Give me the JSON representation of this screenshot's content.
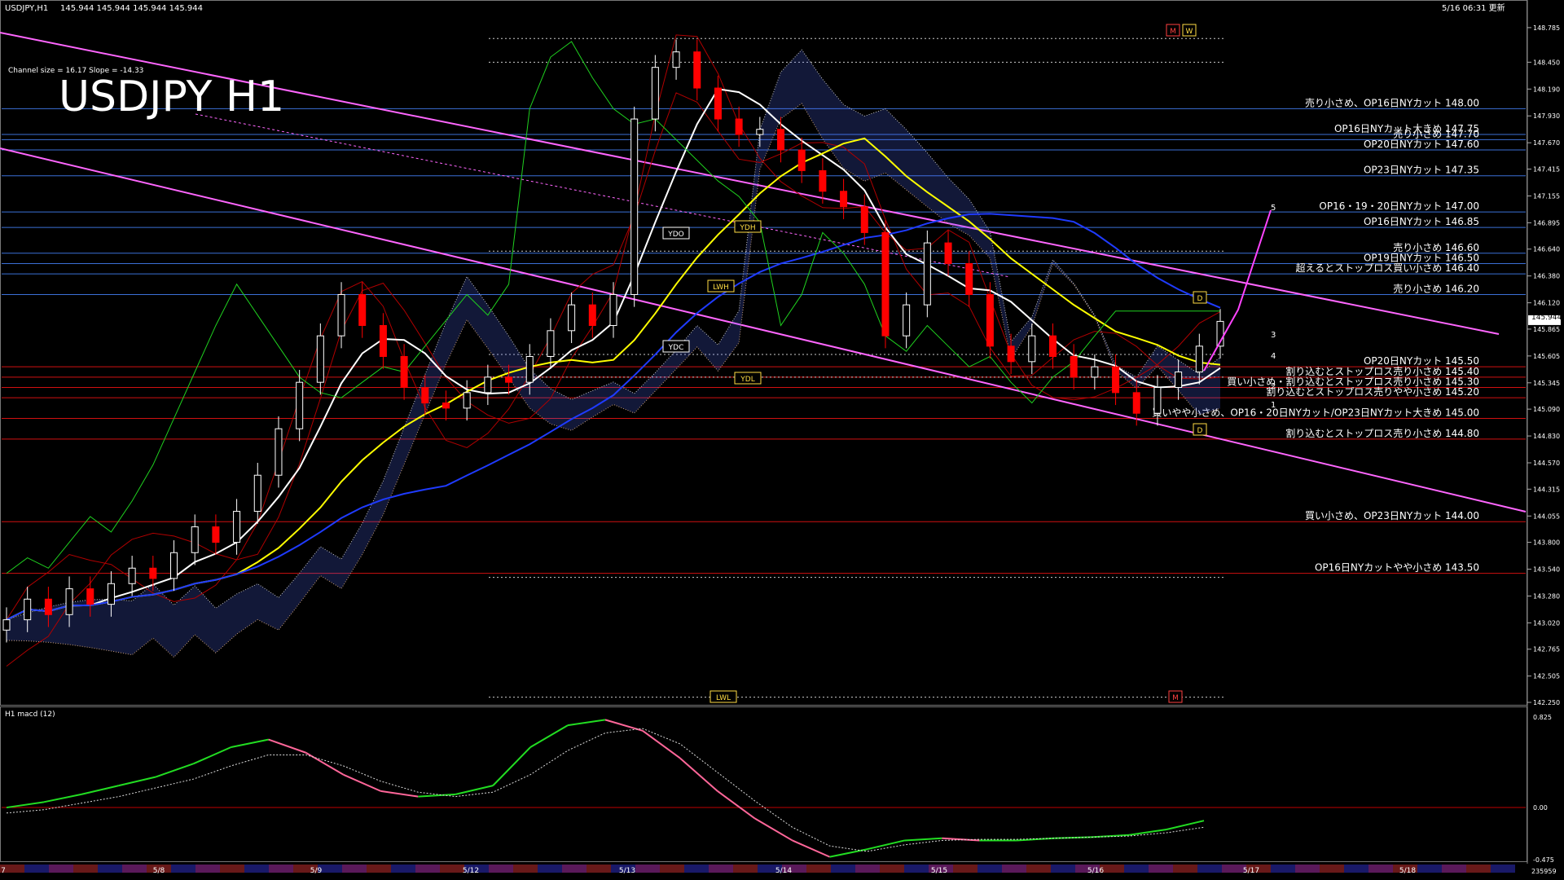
{
  "header": {
    "symbol_info": "USDJPY,H1",
    "prices": "145.944 145.944 145.944 145.944",
    "datetime": "5/16 06:31 更新",
    "channel_info": "Channel size = 16.17 Slope = -14.33",
    "big_title": "USDJPY H1"
  },
  "colors": {
    "background": "#000000",
    "candle_up": "#ffffff",
    "candle_down": "#ff0000",
    "sma_white": "#ffffff",
    "sma_yellow": "#ffff00",
    "sma_blue": "#1f3bff",
    "chikou_green": "#1fd11f",
    "channel_pink": "#ff66ff",
    "level_blue": "#3b6fd6",
    "level_red": "#d01010",
    "macd_green": "#22dd22",
    "macd_pink": "#ff6699",
    "bb_red": "#b00000"
  },
  "chart_data": {
    "type": "candlestick",
    "title": "USDJPY H1",
    "ylim": [
      142.25,
      148.8
    ],
    "last_price": "145.944",
    "y_ticks": [
      "148.785",
      "148.450",
      "148.190",
      "147.930",
      "147.670",
      "147.415",
      "147.155",
      "146.895",
      "146.640",
      "146.380",
      "146.120",
      "145.865",
      "145.605",
      "145.345",
      "145.090",
      "144.830",
      "144.570",
      "144.315",
      "144.055",
      "143.800",
      "143.540",
      "143.280",
      "143.020",
      "142.765",
      "142.505",
      "142.250"
    ],
    "x_ticks": [
      "7",
      "5/8",
      "5/9",
      "5/12",
      "5/13",
      "5/14",
      "5/15",
      "5/16",
      "5/17",
      "5/18"
    ],
    "close_path": [
      143.05,
      143.25,
      143.1,
      143.35,
      143.2,
      143.4,
      143.55,
      143.45,
      143.7,
      143.95,
      143.8,
      144.1,
      144.45,
      144.9,
      145.35,
      145.8,
      146.2,
      145.9,
      145.6,
      145.3,
      145.15,
      145.1,
      145.25,
      145.4,
      145.35,
      145.6,
      145.85,
      146.1,
      145.9,
      146.2,
      147.9,
      148.4,
      148.55,
      148.2,
      147.9,
      147.75,
      147.8,
      147.6,
      147.4,
      147.2,
      147.05,
      146.8,
      145.8,
      146.1,
      146.7,
      146.5,
      146.2,
      145.7,
      145.55,
      145.8,
      145.6,
      145.4,
      145.5,
      145.25,
      145.05,
      145.3,
      145.45,
      145.7,
      145.94
    ],
    "levels": [
      {
        "price": 148.0,
        "label": "売り小さめ、OP16日NYカット 148.00",
        "color": "blue"
      },
      {
        "price": 147.75,
        "label": "OP16日NYカット大きめ 147.75",
        "color": "blue"
      },
      {
        "price": 147.7,
        "label": "売り小さめ 147.70",
        "color": "blue"
      },
      {
        "price": 147.6,
        "label": "OP20日NYカット 147.60",
        "color": "blue"
      },
      {
        "price": 147.35,
        "label": "OP23日NYカット 147.35",
        "color": "blue"
      },
      {
        "price": 147.0,
        "label": "OP16・19・20日NYカット 147.00",
        "color": "blue"
      },
      {
        "price": 146.85,
        "label": "OP16日NYカット 146.85",
        "color": "blue"
      },
      {
        "price": 146.6,
        "label": "売り小さめ 146.60",
        "color": "blue"
      },
      {
        "price": 146.5,
        "label": "OP19日NYカット 146.50",
        "color": "blue"
      },
      {
        "price": 146.4,
        "label": "超えるとストップロス買い小さめ 146.40",
        "color": "blue"
      },
      {
        "price": 146.2,
        "label": "売り小さめ 146.20",
        "color": "blue"
      },
      {
        "price": 145.5,
        "label": "OP20日NYカット 145.50",
        "color": "red"
      },
      {
        "price": 145.4,
        "label": "割り込むとストップロス売り小さめ 145.40",
        "color": "red"
      },
      {
        "price": 145.3,
        "label": "買い小さめ・割り込むとストップロス売り小さめ 145.30",
        "color": "red"
      },
      {
        "price": 145.2,
        "label": "割り込むとストップロス売りやや小さめ 145.20",
        "color": "red"
      },
      {
        "price": 145.0,
        "label": "買いやや小さめ、OP16・20日NYカット/OP23日NYカット大きめ 145.00",
        "color": "red"
      },
      {
        "price": 144.8,
        "label": "割り込むとストップロス売り小さめ 144.80",
        "color": "red"
      },
      {
        "price": 144.0,
        "label": "買い小さめ、OP23日NYカット 144.00",
        "color": "red"
      },
      {
        "price": 143.5,
        "label": "OP16日NYカットやや小さめ 143.50",
        "color": "red"
      }
    ],
    "markers": [
      "M",
      "W",
      "YDO",
      "YDH",
      "LWH",
      "YDC",
      "YDL",
      "LWL",
      "D",
      "M",
      "D"
    ],
    "projection_labels": [
      "5",
      "4",
      "3",
      "2",
      "1"
    ]
  },
  "macd": {
    "label": "H1 macd (12)",
    "y_ticks": [
      "0.825",
      "0.00",
      "-0.475"
    ],
    "ylim": [
      -0.475,
      0.825
    ],
    "main": [
      0.0,
      0.05,
      0.12,
      0.2,
      0.28,
      0.4,
      0.55,
      0.62,
      0.5,
      0.3,
      0.15,
      0.1,
      0.12,
      0.2,
      0.55,
      0.75,
      0.8,
      0.7,
      0.45,
      0.15,
      -0.1,
      -0.3,
      -0.45,
      -0.38,
      -0.3,
      -0.28,
      -0.3,
      -0.3,
      -0.28,
      -0.27,
      -0.25,
      -0.2,
      -0.12
    ],
    "signal": [
      -0.05,
      -0.02,
      0.04,
      0.1,
      0.18,
      0.26,
      0.38,
      0.48,
      0.48,
      0.38,
      0.24,
      0.14,
      0.1,
      0.14,
      0.3,
      0.52,
      0.68,
      0.72,
      0.58,
      0.32,
      0.06,
      -0.18,
      -0.35,
      -0.4,
      -0.34,
      -0.3,
      -0.29,
      -0.29,
      -0.28,
      -0.27,
      -0.26,
      -0.23,
      -0.18
    ]
  },
  "corner_tick": "235959"
}
